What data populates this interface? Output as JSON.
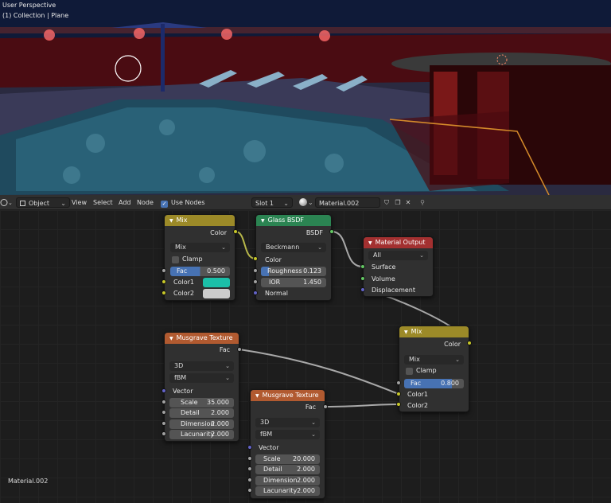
{
  "viewport": {
    "title": "User Perspective",
    "subtitle": "(1) Collection | Plane"
  },
  "header": {
    "mode": "Object",
    "menu": [
      "View",
      "Select",
      "Add",
      "Node"
    ],
    "use_nodes_label": "Use Nodes",
    "use_nodes_checked": true,
    "slot": "Slot 1",
    "material_name": "Material.002"
  },
  "nodes": {
    "mix1": {
      "title": "Mix",
      "output_label": "Color",
      "blend": "Mix",
      "clamp_label": "Clamp",
      "fac_label": "Fac",
      "fac_value": "0.500",
      "color1_label": "Color1",
      "color2_label": "Color2",
      "color1": "#1bbfa8",
      "color2": "#cccccc"
    },
    "glass": {
      "title": "Glass BSDF",
      "output_label": "BSDF",
      "distribution": "Beckmann",
      "color_label": "Color",
      "roughness_label": "Roughness",
      "roughness_value": "0.123",
      "ior_label": "IOR",
      "ior_value": "1.450",
      "normal_label": "Normal"
    },
    "output": {
      "title": "Material Output",
      "target": "All",
      "surface_label": "Surface",
      "volume_label": "Volume",
      "displacement_label": "Displacement"
    },
    "mix2": {
      "title": "Mix",
      "output_label": "Color",
      "blend": "Mix",
      "clamp_label": "Clamp",
      "fac_label": "Fac",
      "fac_value": "0.800",
      "color1_label": "Color1",
      "color2_label": "Color2"
    },
    "musgrave1": {
      "title": "Musgrave Texture",
      "output_label": "Fac",
      "dimensions": "3D",
      "type": "fBM",
      "vector_label": "Vector",
      "scale_label": "Scale",
      "scale_value": "35.000",
      "detail_label": "Detail",
      "detail_value": "2.000",
      "dimension_label": "Dimension",
      "dimension_value": "2.000",
      "lacunarity_label": "Lacunarity",
      "lacunarity_value": "2.000"
    },
    "musgrave2": {
      "title": "Musgrave Texture",
      "output_label": "Fac",
      "dimensions": "3D",
      "type": "fBM",
      "vector_label": "Vector",
      "scale_label": "Scale",
      "scale_value": "20.000",
      "detail_label": "Detail",
      "detail_value": "2.000",
      "dimension_label": "Dimension",
      "dimension_value": "2.000",
      "lacunarity_label": "Lacunarity",
      "lacunarity_value": "2.000"
    }
  },
  "footer_material": "Material.002",
  "icons": [
    "editor-type-icon",
    "object-mode-icon",
    "checkbox-icon",
    "material-sphere-icon",
    "shield-icon",
    "duplicate-icon",
    "close-icon",
    "pin-icon"
  ]
}
